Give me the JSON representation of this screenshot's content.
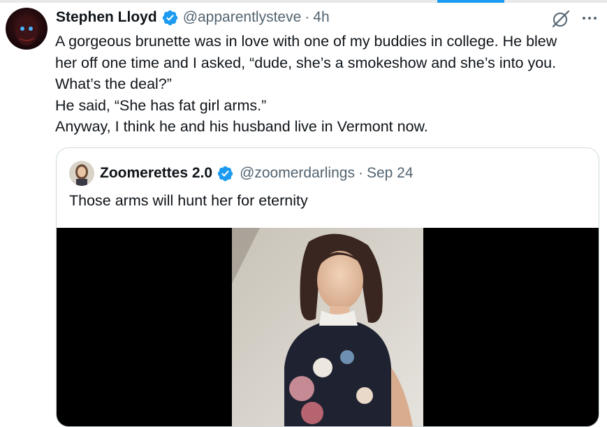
{
  "tweet": {
    "author_name": "Stephen Lloyd",
    "author_handle": "@apparentlysteve",
    "separator": "·",
    "time": "4h",
    "lines": [
      "A gorgeous brunette was in love with one of my buddies in college. He blew",
      "her off one time and I asked, “dude, she’s a smokeshow and she’s into you.",
      "What’s the deal?”",
      "He said, “She has fat girl arms.”",
      "Anyway, I think he and his husband live in Vermont now."
    ],
    "more_label": "···"
  },
  "quoted": {
    "author_name": "Zoomerettes 2.0",
    "author_handle": "@zoomerdarlings",
    "separator": "·",
    "time": "Sep 24",
    "text": "Those arms will hunt her for eternity"
  },
  "colors": {
    "text": "#0f1419",
    "secondary": "#536471",
    "verified": "#1d9bf0",
    "border": "#cfd9de"
  },
  "icons": {
    "verified": "verified-badge-icon",
    "grok": "grok-icon",
    "more": "more-icon"
  }
}
